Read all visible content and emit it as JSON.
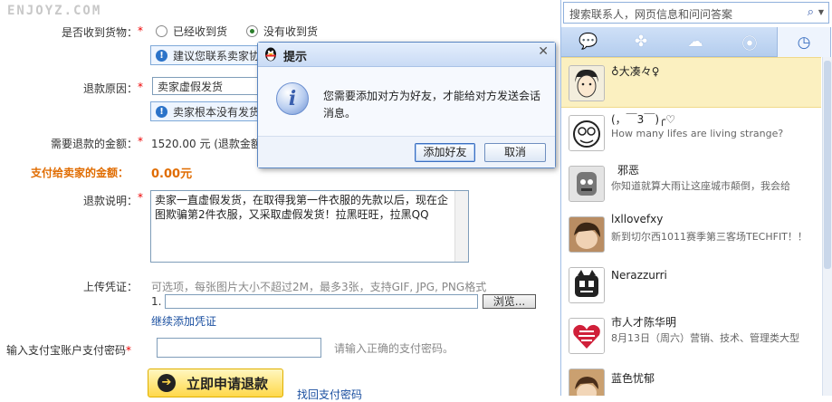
{
  "watermark": "ENJOYZ.COM",
  "form": {
    "received_label": "是否收到货物：",
    "received_options": [
      "已经收到货",
      "没有收到货"
    ],
    "received_tip": "建议您联系卖家协",
    "reason_label": "退款原因：",
    "reason_value": "卖家虚假发货",
    "reason_tip": "卖家根本没有发货",
    "amount_label": "需要退款的金额：",
    "amount_value": "1520.00 元 (退款金额",
    "pay_seller_label": "支付给卖家的金额：",
    "pay_seller_value": "0.00元",
    "desc_label": "退款说明：",
    "desc_text": "卖家一直虚假发货，在取得我第一件衣服的先款以后，现在企图欺骗第2件衣服，又采取虚假发货！拉黑旺旺，拉黑QQ",
    "upload_label": "上传凭证：",
    "upload_hint": "可选项，每张图片大小不超过2M，最多3张，支持GIF, JPG, PNG格式",
    "upload_index": "1.",
    "browse_label": "浏览...",
    "add_more_link": "继续添加凭证",
    "password_label": "输入支付宝账户支付密码",
    "password_hint": "请输入正确的支付密码。",
    "submit_label": "立即申请退款",
    "forgot_link": "找回支付密码",
    "required_mark": "*"
  },
  "dialog": {
    "title": "提示",
    "message": "您需要添加对方为好友，才能给对方发送会话消息。",
    "ok_label": "添加好友",
    "cancel_label": "取消",
    "close_glyph": "✕"
  },
  "qq_panel": {
    "search_placeholder": "搜索联系人，网页信息和问问答案",
    "tabs": [
      "chat-icon",
      "clover-icon",
      "group-icon",
      "qzone-icon",
      "recent-icon"
    ],
    "active_tab": 4,
    "contacts": [
      {
        "name": "♁大凑々♀",
        "signature": ""
      },
      {
        "name": "(，￣3￣)╭♡",
        "signature": "How many lifes are living strange?"
      },
      {
        "name": "邪恶",
        "signature": "你知道就算大雨让这座城市颠倒，我会给"
      },
      {
        "name": "lxllovefxy",
        "signature": "新到切尔西1011赛季第三客场TECHFIT！！"
      },
      {
        "name": "Nerazzurri",
        "signature": ""
      },
      {
        "name": "市人才陈华明",
        "signature": "8月13日（周六）营销、技术、管理类大型"
      },
      {
        "name": "蓝色忧郁",
        "signature": ""
      }
    ]
  },
  "colors": {
    "accent_blue": "#2b73c9",
    "orange_label": "#e06c00",
    "required_red": "#e00000",
    "selected_row": "#fbf0c0",
    "submit_yellow": "#ffd84a"
  }
}
